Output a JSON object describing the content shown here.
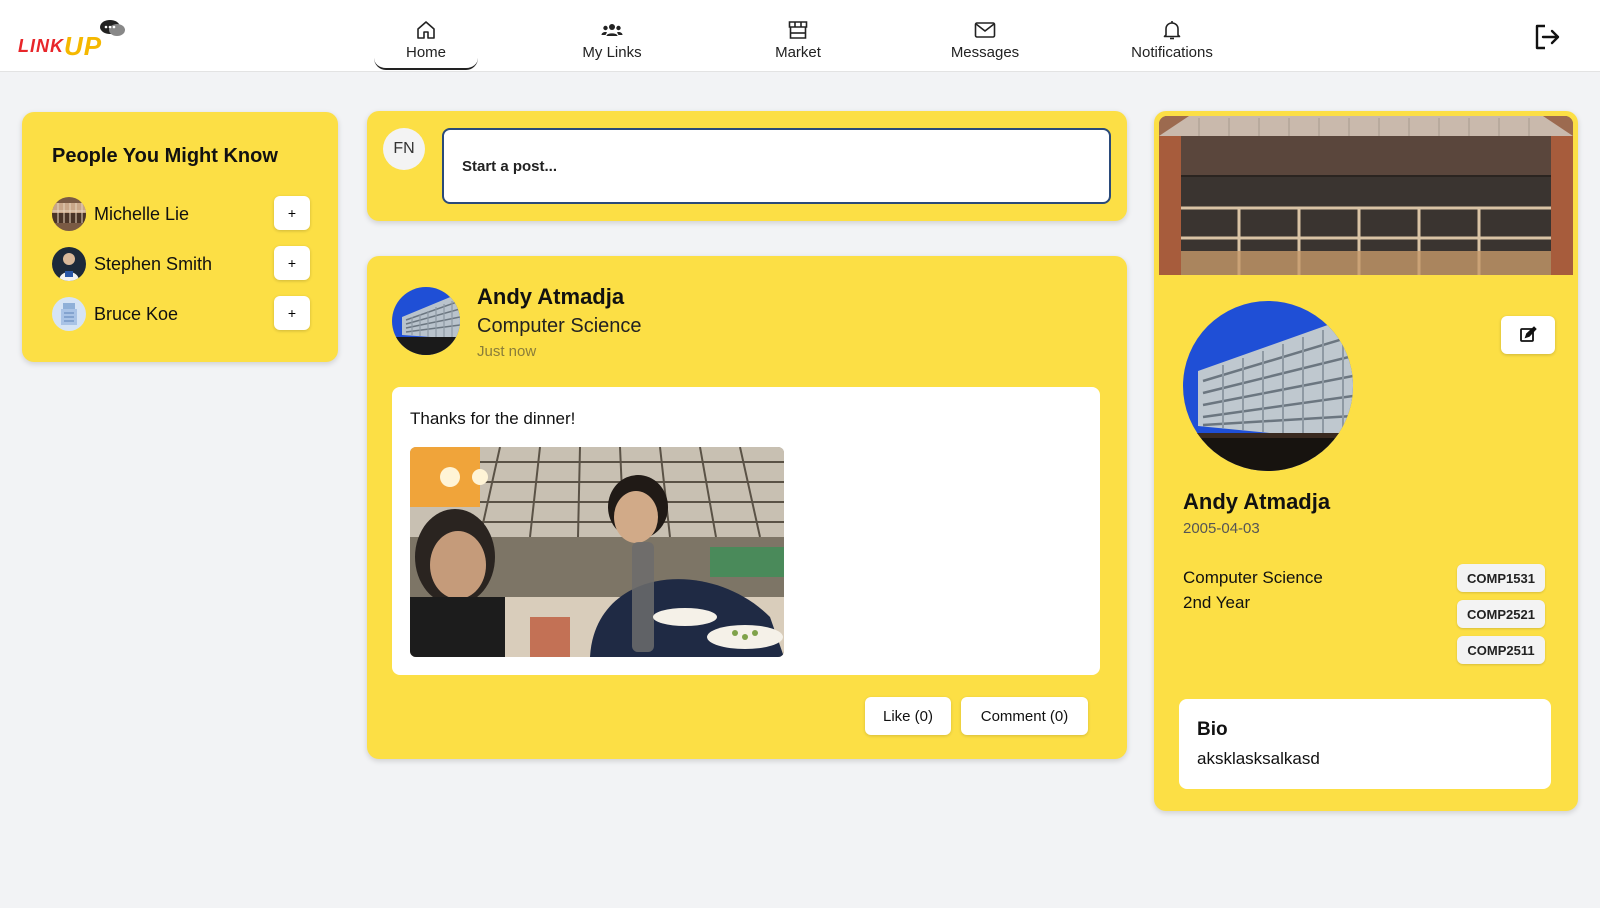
{
  "app": {
    "logo_text_link": "LINK",
    "logo_text_up": "UP",
    "brand_colors": {
      "red": "#e8262a",
      "yellow": "#f5b800",
      "card": "#fcdf45"
    }
  },
  "nav": {
    "items": [
      {
        "label": "Home",
        "icon": "home-icon",
        "active": true
      },
      {
        "label": "My Links",
        "icon": "people-icon",
        "active": false
      },
      {
        "label": "Market",
        "icon": "store-icon",
        "active": false
      },
      {
        "label": "Messages",
        "icon": "mail-icon",
        "active": false
      },
      {
        "label": "Notifications",
        "icon": "bell-icon",
        "active": false
      }
    ],
    "logout_icon": "logout-icon"
  },
  "pymk": {
    "title": "People You Might Know",
    "people": [
      {
        "name": "Michelle Lie",
        "add_label": "+"
      },
      {
        "name": "Stephen Smith",
        "add_label": "+"
      },
      {
        "name": "Bruce Koe",
        "add_label": "+"
      }
    ]
  },
  "composer": {
    "avatar_initials": "FN",
    "placeholder": "Start a post..."
  },
  "post": {
    "author": "Andy Atmadja",
    "major": "Computer Science",
    "time": "Just now",
    "text": "Thanks for the dinner!",
    "like_label": "Like (0)",
    "comment_label": "Comment (0)"
  },
  "profile": {
    "name": "Andy Atmadja",
    "dob": "2005-04-03",
    "major": "Computer Science",
    "year": "2nd Year",
    "courses": [
      "COMP1531",
      "COMP2521",
      "COMP2511"
    ],
    "bio_title": "Bio",
    "bio_text": "aksklasksalkasd"
  }
}
